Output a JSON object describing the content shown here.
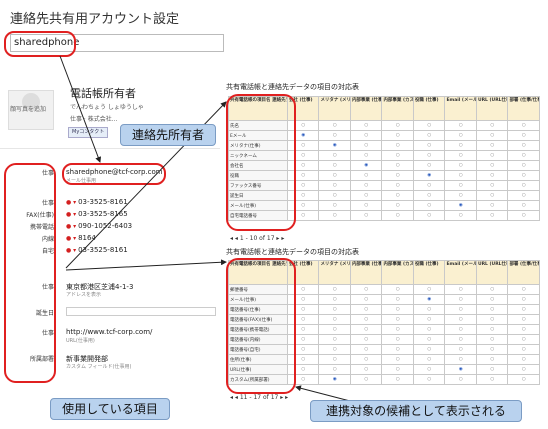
{
  "title": "連絡先共有用アカウント設定",
  "account_input": "sharedphone",
  "profile": {
    "avatar_label": "顔写真を追加",
    "name": "電話帳所有者",
    "line1": "でんわちょう しょゆうしゃ",
    "line2": "仕事  ·  株式会社...",
    "mycontact_button": "Myコンタクト"
  },
  "callouts": {
    "owner": "連絡先所有者",
    "items": "使用している項目",
    "candidates": "連携対象の候補として表示される"
  },
  "fields": [
    {
      "label": "仕事",
      "value": "sharedphone@tcf-corp.com",
      "sub": "メール仕事用"
    },
    {
      "label": "仕事",
      "value": "03-3525-8161",
      "dot": true
    },
    {
      "label": "FAX(仕事)",
      "value": "03-3525-8165",
      "dot": true
    },
    {
      "label": "携帯電話",
      "value": "090-1052-6403",
      "dot": true
    },
    {
      "label": "内線",
      "value": "8164",
      "dot": true
    },
    {
      "label": "自宅",
      "value": "03-3525-8161",
      "dot": true
    },
    {
      "label": "仕事",
      "value": "東京都港区芝浦4-1-3",
      "sub": "アドレスを表示"
    },
    {
      "label": "誕生日",
      "value": ""
    },
    {
      "label": "仕事",
      "value": "http://www.tcf-corp.com/",
      "sub": "URL(仕事用)"
    },
    {
      "label": "所属部署",
      "value": "新事業開発部",
      "sub": "カスタム フィールド(仕事用)"
    }
  ],
  "table1": {
    "title": "共有電話帳と連絡先データの項目の対応表",
    "headers": [
      "共有電話帳の項目名 連絡先データの項目名",
      "会社 (仕事)",
      "メリタナ (メリタナ仕事)",
      "内部事業 (仕事用)",
      "内部事業 (カスタム用仕事)",
      "役職 (仕事)",
      "Email (メール仕事)",
      "URL (URL仕事)",
      "部署 (仕事/仕事)"
    ],
    "rows": [
      "氏名",
      "Eメール",
      "メリタナ(仕事)",
      "ニックネーム",
      "会社名",
      "役職",
      "ファックス番号",
      "誕生日",
      "メール(仕事)",
      "自宅電話番号"
    ],
    "marks": {
      "1": 1,
      "2": 2,
      "4": 3,
      "5": 5,
      "8": 6
    },
    "pager": "1 - 10 of 17"
  },
  "table2": {
    "title": "共有電話帳と連絡先データの項目の対応表",
    "headers": [
      "共有電話帳の項目名 連絡先データの項目名",
      "会社 (仕事)",
      "メリタナ (メリタナ仕事)",
      "内部事業 (仕事用)",
      "内部事業 (カスタム用仕事)",
      "役職 (仕事)",
      "Email (メール仕事)",
      "URL (URL仕事)",
      "部署 (仕事/仕事)"
    ],
    "rows": [
      "郵便番号",
      "メール(仕事)",
      "電話番号(仕事)",
      "電話番号(FAX)(仕事)",
      "電話番号(携帯電話)",
      "電話番号(内線)",
      "電話番号(自宅)",
      "住所(仕事)",
      "URL(仕事)",
      "カスタム(所属部署)"
    ],
    "marks": {
      "1": 5,
      "8": 6,
      "9": 2
    },
    "pager": "11 - 17 of 17"
  }
}
